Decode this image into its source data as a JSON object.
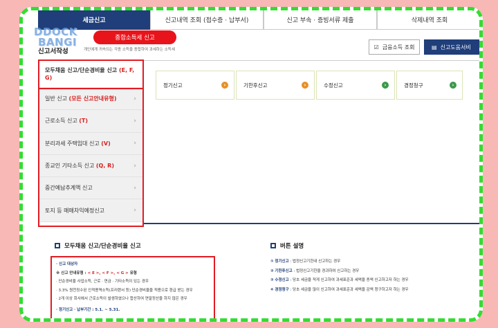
{
  "tabs": [
    {
      "label": "세금신고"
    },
    {
      "label": "신고내역 조회 (접수증 · 납부서)"
    },
    {
      "label": "신고 부속 · 증빙서류 제출"
    },
    {
      "label": "삭제내역 조회"
    }
  ],
  "logo": {
    "line1": "DDOCK",
    "line2": "BANGI"
  },
  "banner": {
    "pill": "종합소득세 신고"
  },
  "page": {
    "title": "신고서작성",
    "desc": "개인에게 귀속되는 각종 소득을 종합하여 과세하는 소득세"
  },
  "buttons": {
    "income_lookup": "금융소득 조회",
    "help": "신고도움서비"
  },
  "sidebar": {
    "items": [
      {
        "label": "모두채움 신고/단순경비율 신고",
        "tag": "(E, F, G)"
      },
      {
        "label": "일반 신고",
        "tag": "(모든 신고안내유형)"
      },
      {
        "label": "근로소득 신고",
        "tag": "(T)"
      },
      {
        "label": "분리과세 주택임대 신고",
        "tag": "(V)"
      },
      {
        "label": "종교인 기타소득 신고",
        "tag": "(Q, R)"
      },
      {
        "label": "중간예납추계액 신고",
        "tag": ""
      },
      {
        "label": "토지 등 매매차익예정신고",
        "tag": ""
      }
    ]
  },
  "report_types": [
    {
      "label": "정기신고",
      "color": "#e8902a"
    },
    {
      "label": "기한후신고",
      "color": "#e8902a"
    },
    {
      "label": "수정신고",
      "color": "#3a9a4a"
    },
    {
      "label": "경정청구",
      "color": "#3a9a4a"
    }
  ],
  "section_left": {
    "title": "모두채움 신고/단순경비율 신고",
    "target_label": "· 신고 대상자",
    "type_prefix": "※ 신고 안내유형 :",
    "type_values": "< E >, < F >, < G >",
    "type_suffix": "유형",
    "bullet1": "· 단순경비율 사업소득, 근로 · 연금 · 기타소득이 있는 경우",
    "bullet2": "· 3.3% 원천징수된 인적용역소득(프리랜서 등) 단순경비율을 적용으로 환급 받는 경우",
    "bullet3": "· 2개 이상 회사에서 근로소득이 발생하였으나 합산하여 연말정산을 하지 않은 경우",
    "period": "· 정기신고 · 납부기간 : 5.1. ~ 5.31."
  },
  "section_right": {
    "title": "버튼 설명",
    "items": [
      {
        "num": "①",
        "key": "정기신고",
        "desc": " : 법정신고기한내 신고하는 경우"
      },
      {
        "num": "②",
        "key": "기한후신고",
        "desc": " : 법정신고기한을 경과하여 신고하는 경우"
      },
      {
        "num": "③",
        "key": "수정신고",
        "desc": " : 당초 세금을 적게 신고하여 과세표준과 세액을 증액 신고하고자 하는 경우"
      },
      {
        "num": "④",
        "key": "경정청구",
        "desc": " : 당초 세금을 많이 신고하여 과세표준과 세액을 감액 청구하고자 하는 경우"
      }
    ]
  },
  "colors": {
    "navy": "#1f3e7a",
    "red": "#e8141b",
    "green_border": "#33dd33",
    "bg": "#f7b8b6"
  }
}
